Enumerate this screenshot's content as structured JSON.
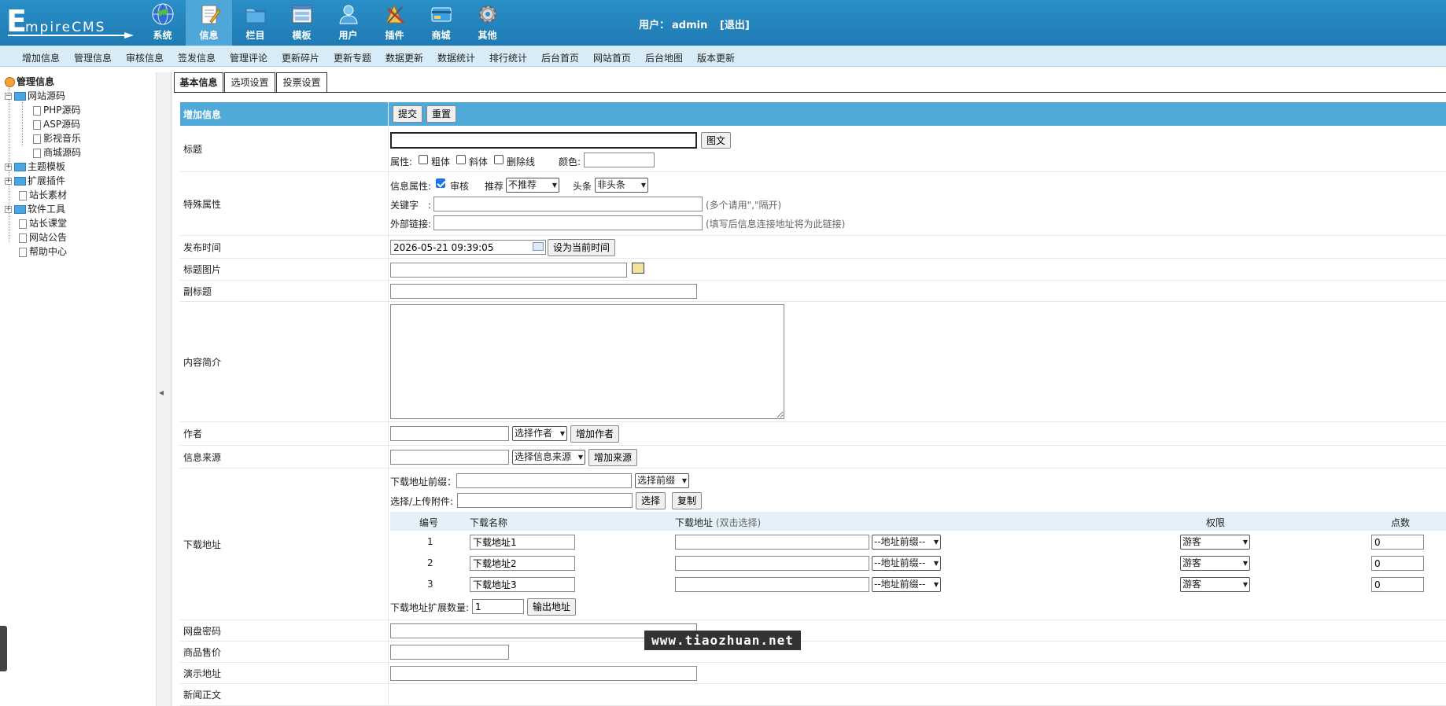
{
  "header": {
    "logo_initial": "E",
    "logo_rest": "mpireCMS",
    "nav": [
      {
        "label": "系统",
        "icon": "globe-icon"
      },
      {
        "label": "信息",
        "icon": "notepad-icon"
      },
      {
        "label": "栏目",
        "icon": "folder-icon"
      },
      {
        "label": "模板",
        "icon": "template-window-icon"
      },
      {
        "label": "用户",
        "icon": "user-icon"
      },
      {
        "label": "插件",
        "icon": "plugin-tools-icon"
      },
      {
        "label": "商城",
        "icon": "shop-card-icon"
      },
      {
        "label": "其他",
        "icon": "gear-icon"
      }
    ],
    "active_nav": "信息",
    "user_prefix": "用户：",
    "username": "admin",
    "logout": "[退出]"
  },
  "subnav": [
    "增加信息",
    "管理信息",
    "审核信息",
    "签发信息",
    "管理评论",
    "更新碎片",
    "更新专题",
    "数据更新",
    "数据统计",
    "排行统计",
    "后台首页",
    "网站首页",
    "后台地图",
    "版本更新"
  ],
  "tree": {
    "root": "管理信息",
    "nodes": [
      {
        "label": "网站源码",
        "type": "folder",
        "expand": "−"
      },
      {
        "label": "PHP源码",
        "type": "doc"
      },
      {
        "label": "ASP源码",
        "type": "doc"
      },
      {
        "label": "影视音乐",
        "type": "doc"
      },
      {
        "label": "商城源码",
        "type": "doc"
      },
      {
        "label": "主题模板",
        "type": "folder",
        "expand": "+"
      },
      {
        "label": "扩展插件",
        "type": "folder",
        "expand": "+"
      },
      {
        "label": "站长素材",
        "type": "doc"
      },
      {
        "label": "软件工具",
        "type": "folder",
        "expand": "+"
      },
      {
        "label": "站长课堂",
        "type": "doc"
      },
      {
        "label": "网站公告",
        "type": "doc"
      },
      {
        "label": "帮助中心",
        "type": "doc"
      }
    ]
  },
  "tabs": [
    "基本信息",
    "选项设置",
    "投票设置"
  ],
  "form": {
    "head": {
      "label": "增加信息",
      "submit": "提交",
      "reset": "重置"
    },
    "title": {
      "label": "标题",
      "value": "",
      "btn": "图文",
      "attr_label": "属性:",
      "bold": "粗体",
      "italic": "斜体",
      "strike": "删除线",
      "color_label": "颜色:"
    },
    "special": {
      "label": "特殊属性",
      "info_attr": "信息属性:",
      "audit": "审核",
      "audit_checked": true,
      "recommend_label": "推荐",
      "recommend_value": "不推荐",
      "headline_label": "头条",
      "headline_value": "非头条",
      "keywords_label": "关键字　:",
      "keywords_hint": "(多个请用\",\"隔开)",
      "link_label": "外部链接:",
      "link_hint": "(填写后信息连接地址将为此链接)"
    },
    "pubtime": {
      "label": "发布时间",
      "value": "2026-05-21 09:39:05",
      "btn": "设为当前时间"
    },
    "titlepic": {
      "label": "标题图片"
    },
    "subtitle": {
      "label": "副标题"
    },
    "summary": {
      "label": "内容简介"
    },
    "author": {
      "label": "作者",
      "select": "选择作者",
      "btn": "增加作者"
    },
    "source": {
      "label": "信息来源",
      "select": "选择信息来源",
      "btn": "增加来源"
    },
    "download": {
      "label": "下载地址",
      "prefix_label": "下载地址前缀：",
      "prefix_select": "选择前缀",
      "upload_label": "选择/上传附件:",
      "choose_btn": "选择",
      "copy_btn": "复制",
      "col_no": "编号",
      "col_name": "下载名称",
      "col_url": "下载地址",
      "col_url_hint": "(双击选择)",
      "col_perm": "权限",
      "col_points": "点数",
      "rows": [
        {
          "no": "1",
          "name": "下载地址1",
          "prefix": "--地址前缀--",
          "perm": "游客",
          "points": "0"
        },
        {
          "no": "2",
          "name": "下载地址2",
          "prefix": "--地址前缀--",
          "perm": "游客",
          "points": "0"
        },
        {
          "no": "3",
          "name": "下载地址3",
          "prefix": "--地址前缀--",
          "perm": "游客",
          "points": "0"
        }
      ],
      "ext_label": "下载地址扩展数量:",
      "ext_value": "1",
      "output_btn": "输出地址"
    },
    "netdisk": {
      "label": "网盘密码"
    },
    "price": {
      "label": "商品售价"
    },
    "demo": {
      "label": "演示地址"
    },
    "body": {
      "label": "新闻正文"
    }
  },
  "watermark": "www.tiaozhuan.net",
  "colors": {
    "header": "#1f7ab3",
    "active_nav": "#4fa6d8",
    "form_head": "#4faad9",
    "subnav": "#d8ecf7"
  }
}
